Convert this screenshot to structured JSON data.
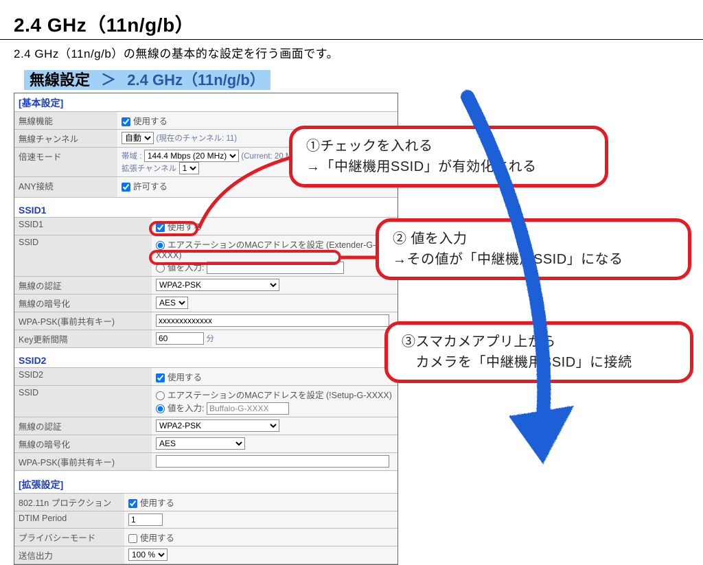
{
  "page": {
    "title": "2.4 GHz（11n/g/b）",
    "desc": "2.4 GHz（11n/g/b）の無線の基本的な設定を行う画面です。"
  },
  "breadcrumb": {
    "left": "無線設定",
    "sep": "＞",
    "right": "2.4 GHz（11n/g/b）"
  },
  "basic": {
    "header": "[基本設定]",
    "rows": {
      "radio_label": "無線機能",
      "radio_use": "使用する",
      "channel_label": "無線チャンネル",
      "channel_value": "自動",
      "channel_note": "(現在のチャンネル: 11)",
      "speed_label": "倍速モード",
      "speed_band_label": "帯域 :",
      "speed_band_value": "144.4 Mbps (20 MHz)",
      "speed_band_note": "(Current: 20 MHz )",
      "speed_ext_label": "拡張チャンネル",
      "speed_ext_value": "1",
      "any_label": "ANY接続",
      "any_allow": "許可する"
    }
  },
  "ssid1": {
    "header": "SSID1",
    "enable_label": "SSID1",
    "enable_use": "使用する",
    "ssid_label": "SSID",
    "ssid_radio_mac": "エアステーションのMACアドレスを設定 (Extender-G-XXXX)",
    "ssid_radio_input": "値を入力:",
    "ssid_input_value": "",
    "auth_label": "無線の認証",
    "auth_value": "WPA2-PSK",
    "enc_label": "無線の暗号化",
    "enc_value": "AES",
    "psk_label": "WPA-PSK(事前共有キー)",
    "psk_value": "xxxxxxxxxxxxx",
    "key_label": "Key更新間隔",
    "key_value": "60",
    "key_unit": "分"
  },
  "ssid2": {
    "header": "SSID2",
    "enable_label": "SSID2",
    "enable_use": "使用する",
    "ssid_label": "SSID",
    "ssid_radio_mac": "エアステーションのMACアドレスを設定 (!Setup-G-XXXX)",
    "ssid_radio_input": "値を入力:",
    "ssid_input_value": "Buffalo-G-XXXX",
    "auth_label": "無線の認証",
    "auth_value": "WPA2-PSK",
    "enc_label": "無線の暗号化",
    "enc_value": "AES",
    "psk_label": "WPA-PSK(事前共有キー)"
  },
  "ext": {
    "header": "[拡張設定]",
    "r1_label": "802.11n プロテクション",
    "r1_use": "使用する",
    "r2_label": "DTIM Period",
    "r2_value": "1",
    "r3_label": "プライバシーモード",
    "r3_use": "使用する",
    "r4_label": "送信出力",
    "r4_value": "100 %"
  },
  "callouts": {
    "c1_l1": "①チェックを入れる",
    "c1_l2": "→「中継機用SSID」が有効化される",
    "c2_l1": "② 値を入力",
    "c2_l2": "→その値が「中継機用SSID」になる",
    "c3_l1": "③スマカメアプリ上から",
    "c3_l2": "　カメラを「中継機用SSID」に接続"
  }
}
